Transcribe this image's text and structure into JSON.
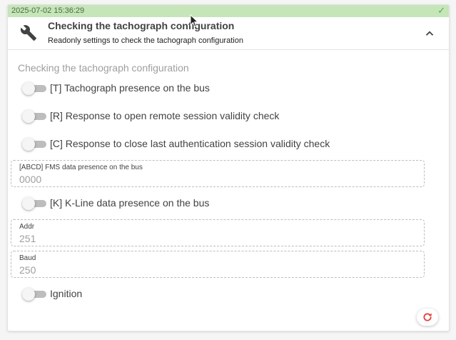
{
  "status": {
    "timestamp": "2025-07-02 15:36:29",
    "color": "#c6e5b9"
  },
  "header": {
    "icon": "wrench-icon",
    "title": "Checking the tachograph configuration",
    "subtitle": "Readonly settings to check the tachograph configuration",
    "collapse_icon": "chevron-up-icon"
  },
  "section": {
    "title": "Checking the tachograph configuration"
  },
  "toggles": {
    "tachograph": {
      "label": "[T] Tachograph presence on the bus",
      "checked": false
    },
    "remote_session": {
      "label": "[R] Response to open remote session validity check",
      "checked": false
    },
    "auth_session": {
      "label": "[C] Response to close last authentication session validity check",
      "checked": false
    },
    "kline": {
      "label": "[K] K-Line data presence on the bus",
      "checked": false
    },
    "ignition": {
      "label": "Ignition",
      "checked": false
    }
  },
  "fields": {
    "fms": {
      "label": "[ABCD] FMS data presence on the bus",
      "value": "0000"
    },
    "addr": {
      "label": "Addr",
      "value": "251"
    },
    "baud": {
      "label": "Baud",
      "value": "250"
    }
  },
  "actions": {
    "reset_icon": "refresh-icon",
    "reset_color": "#e53935"
  }
}
